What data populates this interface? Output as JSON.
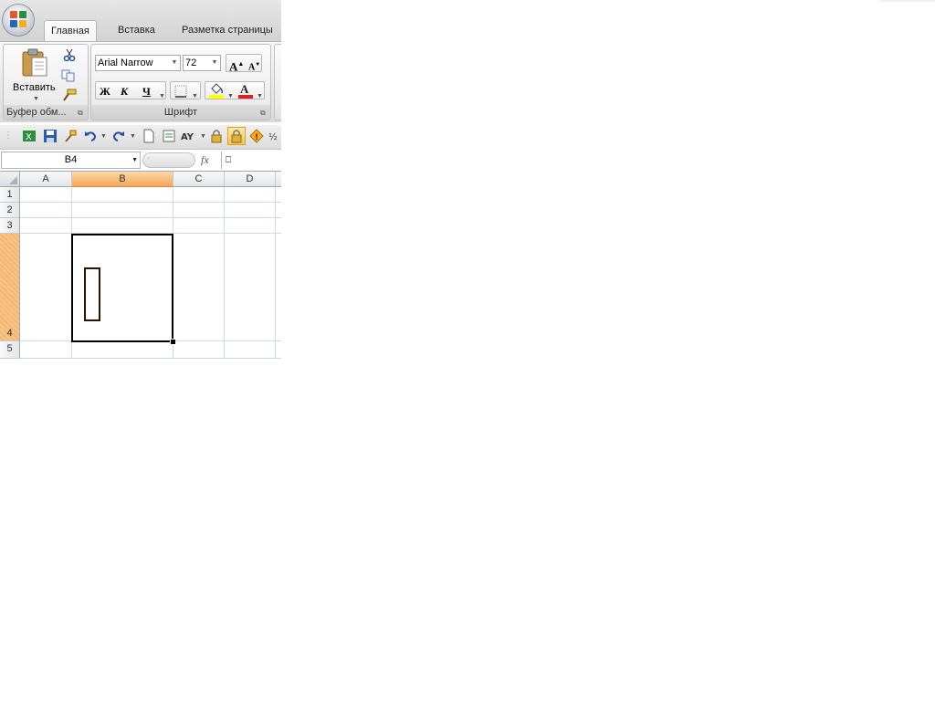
{
  "ribbon": {
    "tabs": [
      {
        "label": "Главная",
        "active": true
      },
      {
        "label": "Вставка",
        "active": false
      },
      {
        "label": "Разметка страницы",
        "active": false
      }
    ],
    "clipboard": {
      "paste_label": "Вставить",
      "group_label": "Буфер обм..."
    },
    "font": {
      "family": "Arial Narrow",
      "size": "72",
      "bold_label": "Ж",
      "italic_label": "К",
      "underline_label": "Ч",
      "font_color_label": "A",
      "grow_label": "A",
      "shrink_label": "A",
      "group_label": "Шрифт"
    }
  },
  "formula_bar": {
    "name_box": "B4",
    "fx_label": "fx",
    "value": "⎕"
  },
  "sheet": {
    "columns": [
      "A",
      "B",
      "C",
      "D"
    ],
    "selected_column": "B",
    "rows": [
      "1",
      "2",
      "3",
      "4",
      "5"
    ],
    "selected_row": "4",
    "active_cell": "B4"
  },
  "colors": {
    "selection_header": "#f5a55c",
    "font_color_bar": "#e02020",
    "fill_color_bar": "#ffff00"
  }
}
